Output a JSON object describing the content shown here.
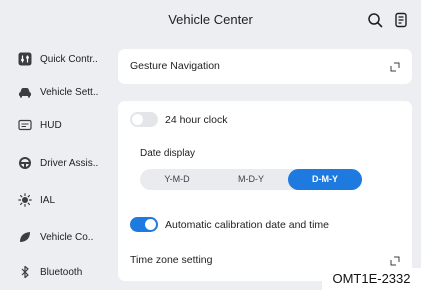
{
  "header": {
    "title": "Vehicle Center",
    "icons": [
      "search-icon",
      "document-icon"
    ]
  },
  "sidebar": {
    "items": [
      {
        "label": "Quick Contr..",
        "icon": "quick-controls-icon"
      },
      {
        "label": "Vehicle Sett..",
        "icon": "car-icon"
      },
      {
        "label": "HUD",
        "icon": "hud-icon"
      },
      {
        "label": "Driver Assis..",
        "icon": "steering-wheel-icon"
      },
      {
        "label": "IAL",
        "icon": "light-icon"
      },
      {
        "label": "Vehicle Co..",
        "icon": "leaf-icon"
      },
      {
        "label": "Bluetooth",
        "icon": "bluetooth-icon"
      }
    ]
  },
  "main": {
    "gesture_navigation": "Gesture Navigation",
    "clock_24h": {
      "label": "24 hour clock",
      "on": false
    },
    "date_display": {
      "label": "Date display",
      "options": [
        "Y-M-D",
        "M-D-Y",
        "D-M-Y"
      ],
      "selected": "D-M-Y"
    },
    "auto_calibration": {
      "label": "Automatic calibration date and time",
      "on": true
    },
    "time_zone": "Time zone setting"
  },
  "watermark": "OMT1E-2332",
  "colors": {
    "accent": "#1f7ae0",
    "background": "#eceef1",
    "card": "#ffffff",
    "toggle_off": "#e3e5e8"
  }
}
